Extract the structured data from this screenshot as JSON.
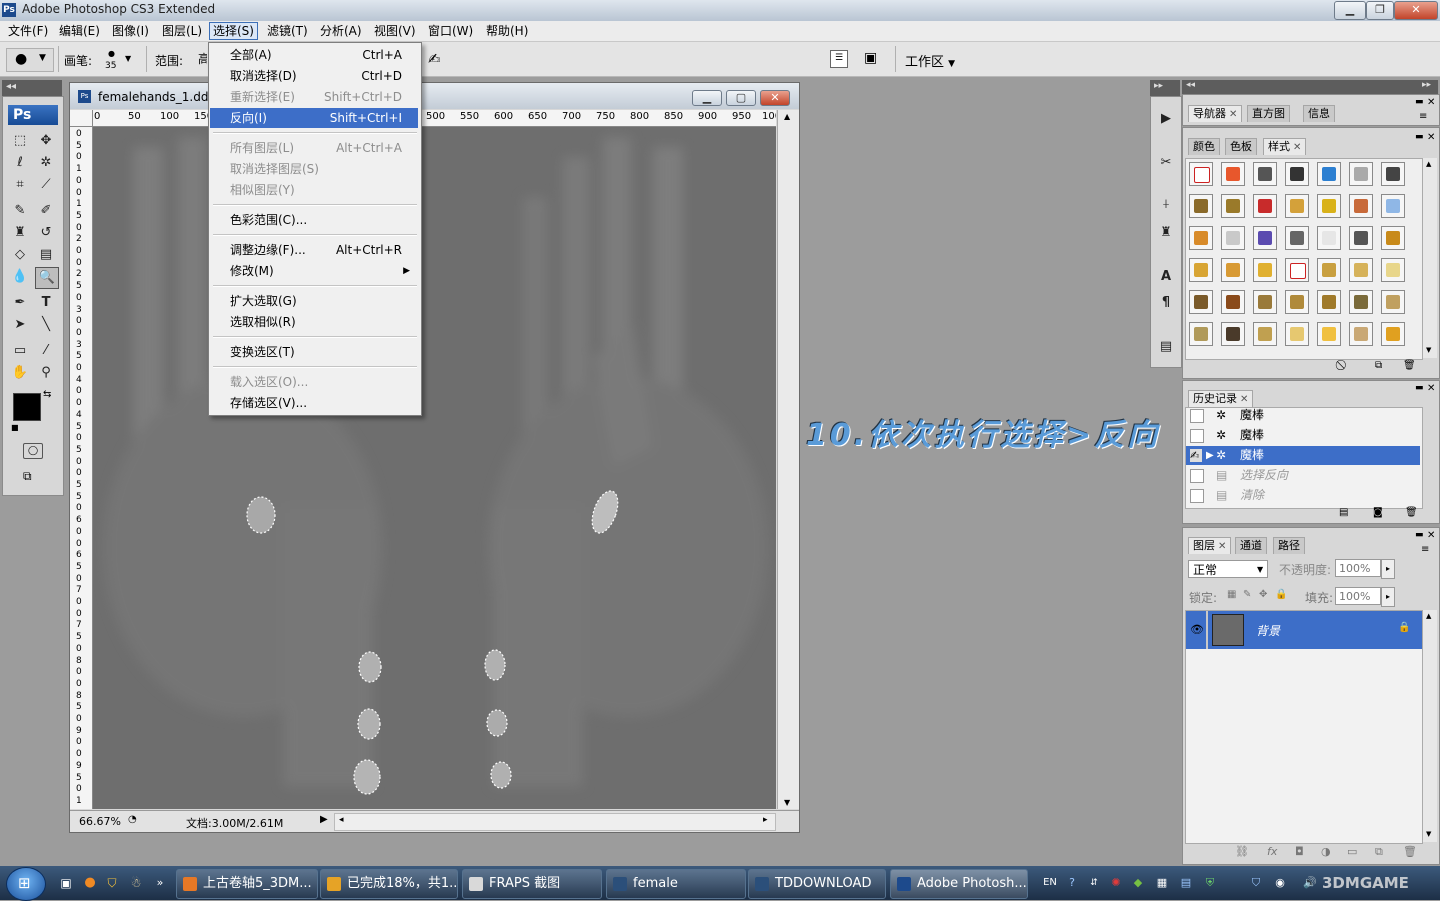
{
  "app": {
    "title": "Adobe Photoshop CS3 Extended",
    "badge": "Ps"
  },
  "menubar": {
    "items": [
      "文件(F)",
      "编辑(E)",
      "图像(I)",
      "图层(L)",
      "选择(S)",
      "滤镜(T)",
      "分析(A)",
      "视图(V)",
      "窗口(W)",
      "帮助(H)"
    ]
  },
  "options": {
    "brush_label": "画笔:",
    "brush_size": "35",
    "range_label": "范围:",
    "range_value": "高",
    "workspace_label": "工作区"
  },
  "select_menu": {
    "items": [
      {
        "label": "全部(A)",
        "shortcut": "Ctrl+A",
        "state": "enabled"
      },
      {
        "label": "取消选择(D)",
        "shortcut": "Ctrl+D",
        "state": "enabled"
      },
      {
        "label": "重新选择(E)",
        "shortcut": "Shift+Ctrl+D",
        "state": "disabled"
      },
      {
        "label": "反向(I)",
        "shortcut": "Shift+Ctrl+I",
        "state": "highlighted"
      },
      {
        "label": "所有图层(L)",
        "shortcut": "Alt+Ctrl+A",
        "state": "disabled"
      },
      {
        "label": "取消选择图层(S)",
        "shortcut": "",
        "state": "disabled"
      },
      {
        "label": "相似图层(Y)",
        "shortcut": "",
        "state": "disabled"
      },
      {
        "label": "色彩范围(C)...",
        "shortcut": "",
        "state": "enabled"
      },
      {
        "label": "调整边缘(F)...",
        "shortcut": "Alt+Ctrl+R",
        "state": "enabled"
      },
      {
        "label": "修改(M)",
        "shortcut": "",
        "state": "submenu"
      },
      {
        "label": "扩大选取(G)",
        "shortcut": "",
        "state": "enabled"
      },
      {
        "label": "选取相似(R)",
        "shortcut": "",
        "state": "enabled"
      },
      {
        "label": "变换选区(T)",
        "shortcut": "",
        "state": "enabled"
      },
      {
        "label": "载入选区(O)...",
        "shortcut": "",
        "state": "disabled"
      },
      {
        "label": "存储选区(V)...",
        "shortcut": "",
        "state": "enabled"
      }
    ]
  },
  "document": {
    "title": "femalehands_1.dds",
    "ruler_labels": [
      "0",
      "50",
      "100",
      "150",
      "500",
      "550",
      "600",
      "650",
      "700",
      "750",
      "800",
      "850",
      "900",
      "950",
      "100"
    ],
    "ruler_v_digits": [
      "0",
      "5",
      "0",
      "1",
      "0",
      "0",
      "1",
      "5",
      "0",
      "2",
      "0",
      "0",
      "2",
      "5",
      "0",
      "3",
      "0",
      "0",
      "3",
      "5",
      "0",
      "4",
      "0",
      "0",
      "4",
      "5",
      "0",
      "5",
      "0",
      "0",
      "5",
      "5",
      "0",
      "6",
      "0",
      "0",
      "6",
      "5",
      "0",
      "7",
      "0",
      "0",
      "7",
      "5",
      "0",
      "8",
      "0",
      "0",
      "8",
      "5",
      "0",
      "9",
      "0",
      "0",
      "9",
      "5",
      "0",
      "1"
    ],
    "zoom": "66.67%",
    "doc_size": "文档:3.00M/2.61M"
  },
  "annotation": "10.依次执行选择>反向",
  "panels": {
    "nav_tabs": [
      "导航器",
      "直方图",
      "信息"
    ],
    "color_tabs": [
      "颜色",
      "色板",
      "样式"
    ],
    "history_tab": "历史记录",
    "history_items": [
      {
        "label": "魔棒",
        "state": "normal"
      },
      {
        "label": "魔棒",
        "state": "normal"
      },
      {
        "label": "魔棒",
        "state": "selected"
      },
      {
        "label": "选择反向",
        "state": "undone"
      },
      {
        "label": "清除",
        "state": "undone"
      }
    ],
    "layers_tabs": [
      "图层",
      "通道",
      "路径"
    ],
    "blend_mode": "正常",
    "opacity_label": "不透明度:",
    "opacity_value": "100%",
    "lock_label": "锁定:",
    "fill_label": "填充:",
    "fill_value": "100%",
    "layer_name": "背景"
  },
  "taskbar": {
    "buttons": [
      "上古卷轴5_3DM...",
      "已完成18%，共1...",
      "FRAPS 截图",
      "female",
      "TDDOWNLOAD",
      "Adobe Photosh..."
    ],
    "lang": "EN",
    "watermark": "3DMGAME"
  },
  "colors": {
    "highlight": "#3d6ec8",
    "annotation": "#5a9bd8",
    "canvas": "#6e6e6e"
  }
}
